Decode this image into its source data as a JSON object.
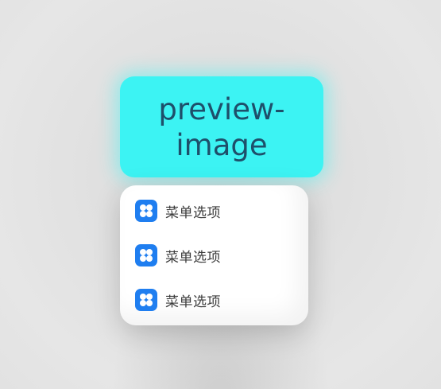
{
  "preview": {
    "label": "preview-image",
    "background_color": "#3cf3f3",
    "text_color": "#1e4f6a"
  },
  "menu": {
    "items": [
      {
        "label": "菜单选项",
        "icon": "app-grid-icon"
      },
      {
        "label": "菜单选项",
        "icon": "app-grid-icon"
      },
      {
        "label": "菜单选项",
        "icon": "app-grid-icon"
      }
    ],
    "icon_color": "#1f7ef0"
  }
}
